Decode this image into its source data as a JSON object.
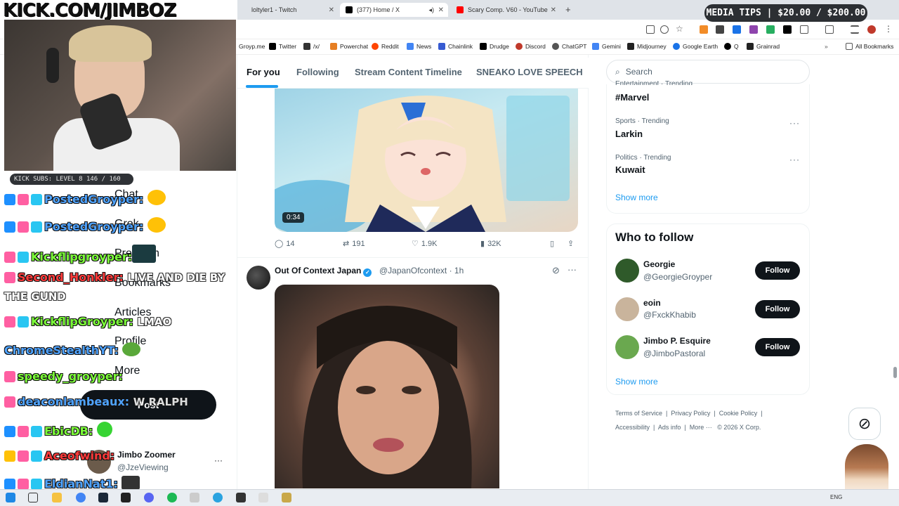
{
  "browser": {
    "tabs": [
      {
        "label": "loltyler1 - Twitch",
        "color": "#9146ff"
      },
      {
        "label": "(377) Home / X",
        "color": "#000000"
      },
      {
        "label": "Scary Comp. V60 - YouTube",
        "color": "#ff0000"
      }
    ],
    "bookmarks": [
      "Groyp.me",
      "Twitter",
      "/x/",
      "Powerchat",
      "Reddit",
      "News",
      "Chainlink",
      "Drudge",
      "Discord",
      "ChatGPT",
      "Gemini",
      "Midjourney",
      "Google Earth",
      "Q",
      "Grainrad"
    ],
    "all_bookmarks": "All Bookmarks"
  },
  "x": {
    "tabs": [
      "For you",
      "Following",
      "Stream Content Timeline",
      "SNEAKO LOVE SPEECH"
    ],
    "post1": {
      "duration": "0:34",
      "replies": "14",
      "reposts": "191",
      "likes": "1.9K",
      "views": "32K"
    },
    "post2": {
      "name": "Out Of Context Japan",
      "handle": "@JapanOfcontext",
      "time": "· 1h"
    },
    "search_placeholder": "Search",
    "trends": [
      {
        "category": "Entertainment · Trending",
        "name": "#Marvel"
      },
      {
        "category": "Sports · Trending",
        "name": "Larkin"
      },
      {
        "category": "Politics · Trending",
        "name": "Kuwait"
      }
    ],
    "show_more": "Show more",
    "who_to_follow": "Who to follow",
    "follow_suggestions": [
      {
        "name": "Georgie",
        "handle": "@GeorgieGroyper",
        "color": "#2f5a2a"
      },
      {
        "name": "eoin",
        "handle": "@FxckKhabib",
        "color": "#c9b49c"
      },
      {
        "name": "Jimbo P. Esquire",
        "handle": "@JimboPastoral",
        "color": "#6aa84f"
      }
    ],
    "follow_label": "Follow",
    "footer": {
      "line1": "Terms of Service  |  Privacy Policy  |  Cookie Policy  |",
      "line2": "Accessibility  |  Ads info  |  More ···   © 2026 X Corp."
    },
    "left_nav": [
      "Chat",
      "Grok",
      "Premium",
      "Bookmarks",
      "Articles",
      "Profile",
      "More"
    ],
    "post_label": "Post",
    "account": {
      "name": "Jimbo Zoomer",
      "handle": "@JzeViewing"
    }
  },
  "stream": {
    "banner": "KICK.COM/JIMBOZ",
    "subs": "KICK SUBS: LEVEL 8 146 / 160",
    "media_tips": "MEDIA TIPS | $20.00 / $200.00",
    "chat": [
      {
        "user": "PostedGroyper:",
        "msg": "",
        "color": "#4fa3ff"
      },
      {
        "user": "PostedGroyper:",
        "msg": "",
        "color": "#4fa3ff"
      },
      {
        "user": "Kickflipgroyper:",
        "msg": "",
        "color": "#7dff3a"
      },
      {
        "user": "Second_Honkler:",
        "msg": "LIVE AND DIE BY",
        "color": "#ff3b3b"
      },
      {
        "user": "",
        "msg": "THE GUND",
        "color": "#ffffff"
      },
      {
        "user": "KickflipGroyper:",
        "msg": "LMAO",
        "color": "#7dff3a"
      },
      {
        "user": "ChromeStealthYT:",
        "msg": "",
        "color": "#4fa3ff"
      },
      {
        "user": "speedy_groyper:",
        "msg": "",
        "color": "#7dff3a"
      },
      {
        "user": "deaconlambeaux:",
        "msg": "W RALPH",
        "color": "#4fa3ff"
      },
      {
        "user": "EbicDB:",
        "msg": "",
        "color": "#7dff3a"
      },
      {
        "user": "Aceofwind:",
        "msg": "",
        "color": "#ff3b3b"
      },
      {
        "user": "EldianNat1:",
        "msg": "",
        "color": "#4fa3ff"
      }
    ]
  },
  "taskbar": {
    "lang": "ENG"
  }
}
